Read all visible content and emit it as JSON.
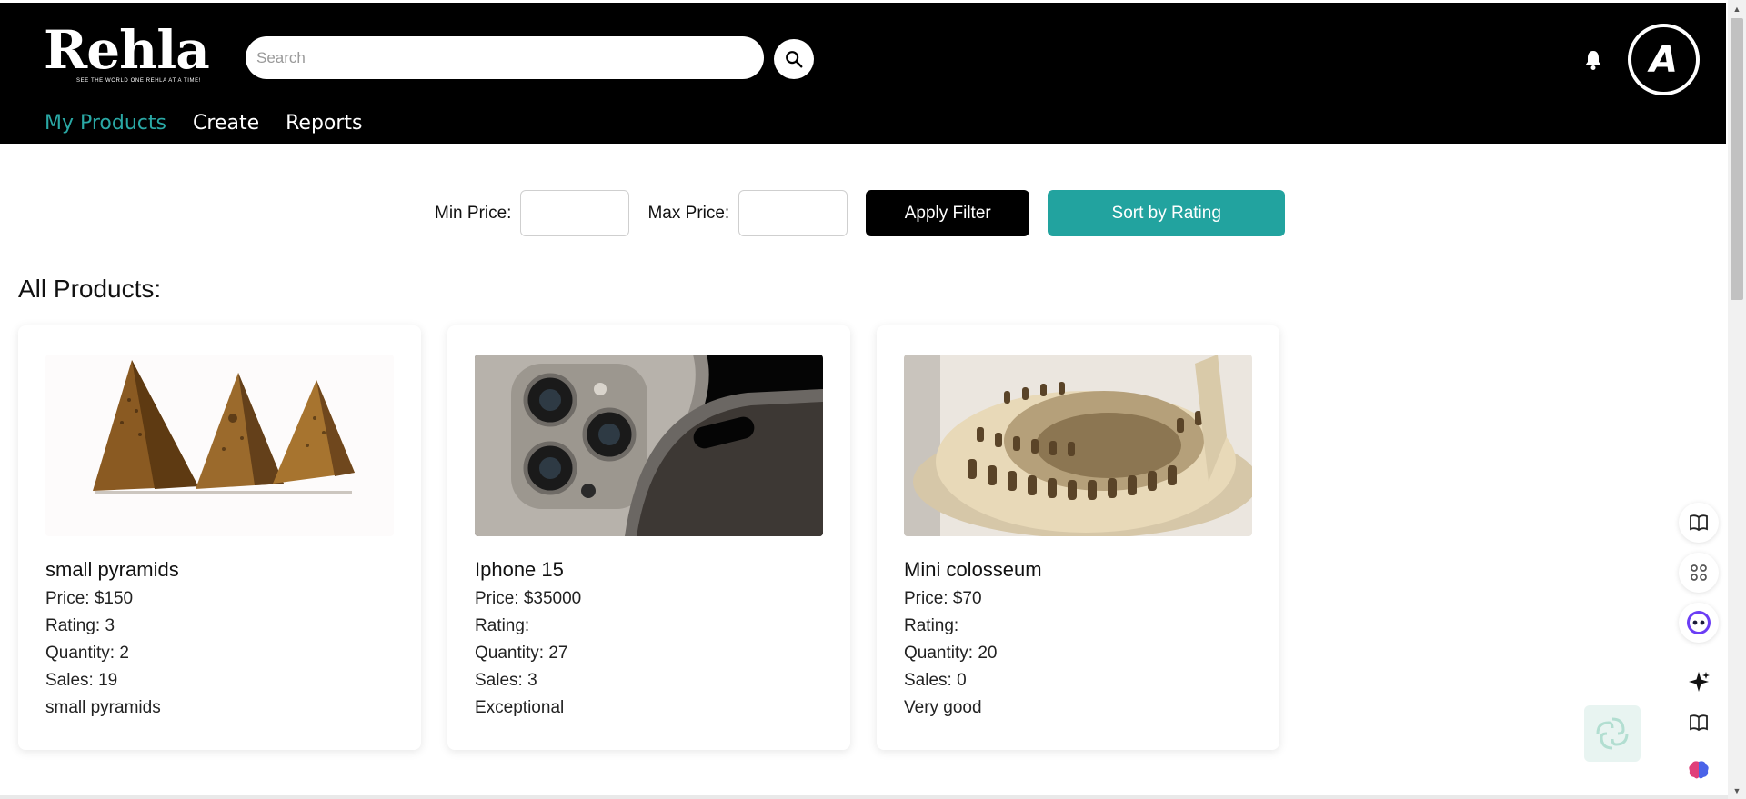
{
  "brand": {
    "logo_text": "Rehla",
    "tagline": "SEE THE WORLD ONE REHLA AT A TIME!"
  },
  "search": {
    "placeholder": "Search"
  },
  "user": {
    "avatar_letter": "A"
  },
  "nav": {
    "items": [
      {
        "label": "My Products",
        "active": true
      },
      {
        "label": "Create"
      },
      {
        "label": "Reports"
      }
    ]
  },
  "filters": {
    "min_label": "Min Price:",
    "max_label": "Max Price:",
    "min_value": "",
    "max_value": "",
    "apply_label": "Apply Filter",
    "sort_label": "Sort by Rating"
  },
  "section_title": "All Products:",
  "products": [
    {
      "name": "small pyramids",
      "price": "Price: $150",
      "rating": "Rating: 3",
      "quantity": "Quantity: 2",
      "sales": "Sales: 19",
      "description": "small pyramids"
    },
    {
      "name": "Iphone 15",
      "price": "Price: $35000",
      "rating": "Rating:",
      "quantity": "Quantity: 27",
      "sales": "Sales: 3",
      "description": "Exceptional"
    },
    {
      "name": "Mini colosseum",
      "price": "Price: $70",
      "rating": "Rating:",
      "quantity": "Quantity: 20",
      "sales": "Sales: 0",
      "description": "Very good"
    }
  ],
  "colors": {
    "accent": "#22a39f",
    "header_bg": "#000000",
    "active_nav": "#2aa8a5"
  }
}
